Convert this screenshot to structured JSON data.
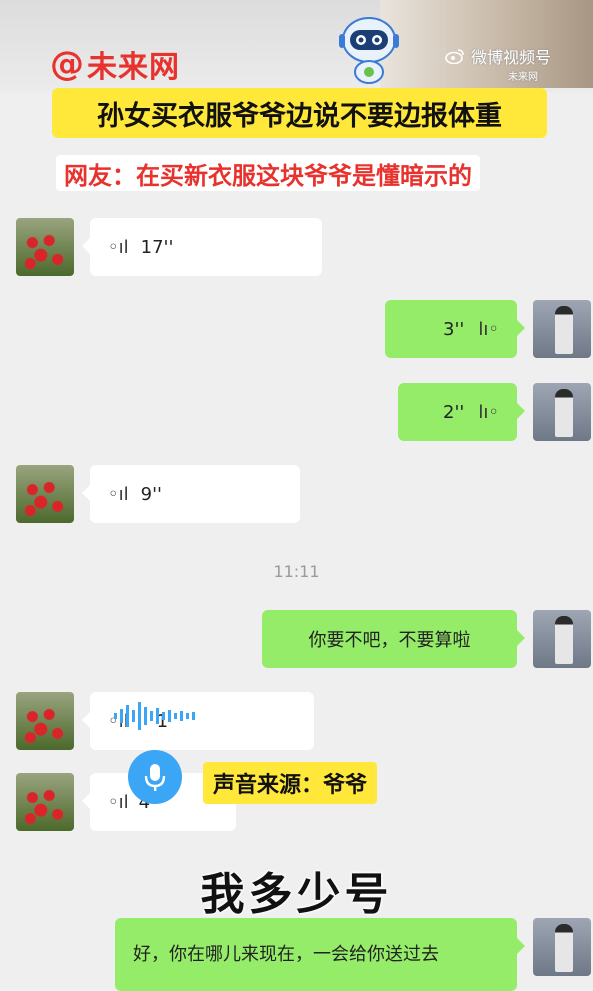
{
  "brand": {
    "at": "@",
    "name": "未来网"
  },
  "weibo": {
    "label": "微博视频号",
    "sub": "未来网"
  },
  "headline": "孙女买衣服爷爷边说不要边报体重",
  "subline": "网友：在买新衣服这块爷爷是懂暗示的",
  "messages": [
    {
      "side": "left",
      "type": "voice",
      "duration": "17''"
    },
    {
      "side": "right",
      "type": "voice",
      "duration": "3''"
    },
    {
      "side": "right",
      "type": "voice",
      "duration": "2''"
    },
    {
      "side": "left",
      "type": "voice",
      "duration": "9''"
    },
    {
      "side": "right",
      "type": "text",
      "text": "你要不吧，不要算啦"
    },
    {
      "side": "left",
      "type": "voice",
      "duration": "1"
    },
    {
      "side": "left",
      "type": "voice",
      "duration": "4"
    },
    {
      "side": "right",
      "type": "text",
      "text": "好，你在哪儿来现在，一会给你送过去"
    }
  ],
  "timestamp": "11:11",
  "voice_source": "声音来源：爷爷",
  "caption": "我多少号",
  "colors": {
    "accent_red": "#e8322d",
    "highlight_yellow": "#ffe83a",
    "bubble_green": "#95ec69",
    "mic_blue": "#3aa6f5"
  }
}
